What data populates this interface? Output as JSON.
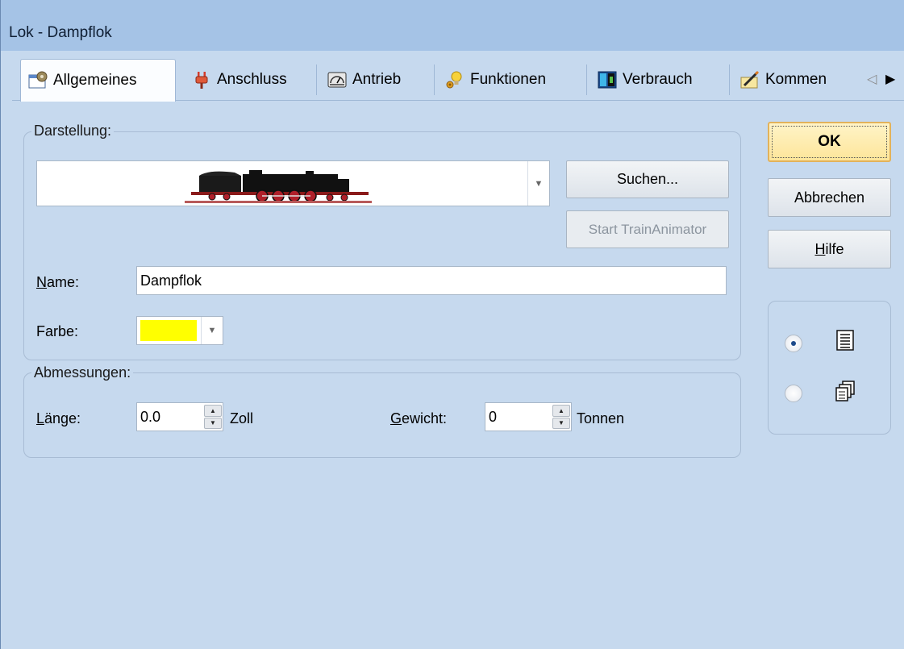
{
  "window": {
    "title": "Lok - Dampflok"
  },
  "tabs": [
    {
      "label": "Allgemeines",
      "icon": "window-settings-icon",
      "active": true
    },
    {
      "label": "Anschluss",
      "icon": "plug-icon",
      "active": false
    },
    {
      "label": "Antrieb",
      "icon": "gauge-icon",
      "active": false
    },
    {
      "label": "Funktionen",
      "icon": "lightbulb-icon",
      "active": false
    },
    {
      "label": "Verbrauch",
      "icon": "meter-icon",
      "active": false
    },
    {
      "label": "Kommen",
      "icon": "pencil-note-icon",
      "active": false
    }
  ],
  "darstellung": {
    "legend": "Darstellung:",
    "image": "steam-locomotive-image",
    "search_button": "Suchen...",
    "animator_button": "Start TrainAnimator"
  },
  "name_field": {
    "label": "Name:",
    "value": "Dampflok"
  },
  "color_field": {
    "label": "Farbe:",
    "value_color": "#ffff00"
  },
  "abmessungen": {
    "legend": "Abmessungen:",
    "length_label": "Länge:",
    "length_value": "0.0",
    "length_unit": "Zoll",
    "weight_label": "Gewicht:",
    "weight_value": "0",
    "weight_unit": "Tonnen"
  },
  "buttons": {
    "ok": "OK",
    "cancel": "Abbrechen",
    "help": "Hilfe"
  },
  "view_mode": {
    "selected": "single",
    "options": [
      "single",
      "multiple"
    ]
  },
  "colors": {
    "background": "#c6d9ee",
    "titlebar": "#a5c3e6",
    "ok_border": "#e3b25a"
  }
}
